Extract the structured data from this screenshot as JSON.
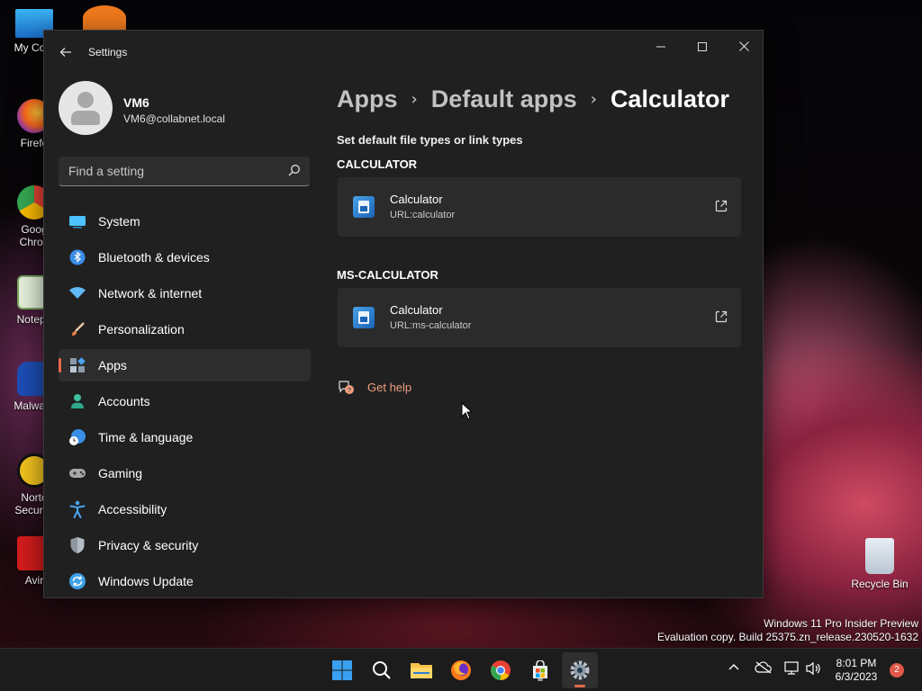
{
  "desktop": {
    "icons": [
      {
        "label": "My Com",
        "icon": "monitor-icon"
      },
      {
        "label": "Firefo",
        "icon": "firefox-icon"
      },
      {
        "label": "Goog",
        "label2": "Chron",
        "icon": "chrome-icon"
      },
      {
        "label": "Notepa",
        "icon": "notepad-icon"
      },
      {
        "label": "Malware",
        "icon": "malwarebytes-icon"
      },
      {
        "label": "Norto",
        "label2": "Security",
        "icon": "norton-icon"
      },
      {
        "label": "Avir",
        "icon": "avira-icon"
      }
    ],
    "recycle_bin_label": "Recycle Bin",
    "watermark_line1": "Windows 11 Pro Insider Preview",
    "watermark_line2": "Evaluation copy. Build 25375.zn_release.230520-1632"
  },
  "window": {
    "title": "Settings",
    "back_icon": "back-arrow-icon",
    "controls": [
      "minimize-icon",
      "maximize-icon",
      "close-icon"
    ]
  },
  "profile": {
    "name": "VM6",
    "email": "VM6@collabnet.local"
  },
  "search": {
    "placeholder": "Find a setting"
  },
  "nav": {
    "items": [
      {
        "label": "System",
        "icon": "system-icon",
        "color": "#4cc2ff"
      },
      {
        "label": "Bluetooth & devices",
        "icon": "bluetooth-icon",
        "color": "#4aa3f0"
      },
      {
        "label": "Network & internet",
        "icon": "wifi-icon",
        "color": "#60b8f5"
      },
      {
        "label": "Personalization",
        "icon": "brush-icon",
        "color": "#e8a070"
      },
      {
        "label": "Apps",
        "icon": "apps-icon",
        "color": "#a8b8c8",
        "active": true
      },
      {
        "label": "Accounts",
        "icon": "accounts-icon",
        "color": "#3fc1a0"
      },
      {
        "label": "Time & language",
        "icon": "globe-clock-icon",
        "color": "#4aa3f0"
      },
      {
        "label": "Gaming",
        "icon": "gamepad-icon",
        "color": "#a0a0a0"
      },
      {
        "label": "Accessibility",
        "icon": "accessibility-icon",
        "color": "#4aa3f0"
      },
      {
        "label": "Privacy & security",
        "icon": "shield-icon",
        "color": "#9aa0a8"
      },
      {
        "label": "Windows Update",
        "icon": "update-icon",
        "color": "#3da0e8"
      }
    ]
  },
  "breadcrumb": {
    "items": [
      "Apps",
      "Default apps",
      "Calculator"
    ]
  },
  "content": {
    "description": "Set default file types or link types",
    "groups": [
      {
        "header": "CALCULATOR",
        "app_name": "Calculator",
        "link_type": "URL:calculator"
      },
      {
        "header": "MS-CALCULATOR",
        "app_name": "Calculator",
        "link_type": "URL:ms-calculator"
      }
    ],
    "help_label": "Get help"
  },
  "taskbar": {
    "apps": [
      "start-icon",
      "search-icon",
      "file-explorer-icon",
      "firefox-icon",
      "chrome-icon",
      "store-icon",
      "settings-icon"
    ],
    "time": "8:01 PM",
    "date": "6/3/2023",
    "notification_count": "2",
    "accent": "#e7694a"
  }
}
